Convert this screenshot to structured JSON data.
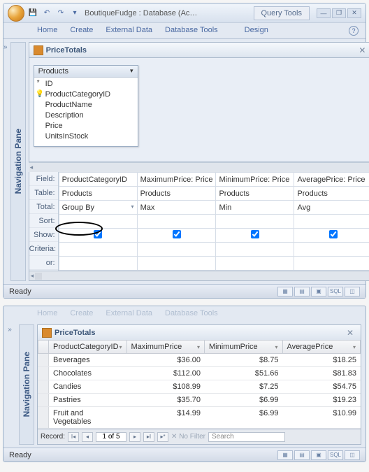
{
  "app_title": "BoutiqueFudge : Database (Ac…",
  "query_tools": "Query Tools",
  "ribbon": [
    "Home",
    "Create",
    "External Data",
    "Database Tools"
  ],
  "design_tab": "Design",
  "nav_pane_label": "Navigation Pane",
  "object_tab": "PriceTotals",
  "table_box": {
    "title": "Products",
    "fields": [
      "ID",
      "ProductCategoryID",
      "ProductName",
      "Description",
      "Price",
      "UnitsInStock"
    ]
  },
  "grid_labels": [
    "Field:",
    "Table:",
    "Total:",
    "Sort:",
    "Show:",
    "Criteria:",
    "or:"
  ],
  "grid": [
    {
      "field": "ProductCategoryID",
      "table": "Products",
      "total": "Group By",
      "show": true
    },
    {
      "field": "MaximumPrice: Price",
      "table": "Products",
      "total": "Max",
      "show": true
    },
    {
      "field": "MinimumPrice: Price",
      "table": "Products",
      "total": "Min",
      "show": true
    },
    {
      "field": "AveragePrice: Price",
      "table": "Products",
      "total": "Avg",
      "show": true
    }
  ],
  "status_text": "Ready",
  "view_icons": [
    "▦",
    "▤",
    "▣",
    "SQL",
    "◫"
  ],
  "datasheet": {
    "columns": [
      "ProductCategoryID",
      "MaximumPrice",
      "MinimumPrice",
      "AveragePrice"
    ],
    "rows": [
      {
        "cat": "Beverages",
        "max": "$36.00",
        "min": "$8.75",
        "avg": "$18.25"
      },
      {
        "cat": "Chocolates",
        "max": "$112.00",
        "min": "$51.66",
        "avg": "$81.83"
      },
      {
        "cat": "Candies",
        "max": "$108.99",
        "min": "$7.25",
        "avg": "$54.75"
      },
      {
        "cat": "Pastries",
        "max": "$35.70",
        "min": "$6.99",
        "avg": "$19.23"
      },
      {
        "cat": "Fruit and Vegetables",
        "max": "$14.99",
        "min": "$6.99",
        "avg": "$10.99"
      }
    ]
  },
  "record_nav": {
    "label": "Record:",
    "pos": "1 of 5",
    "nofilter": "No Filter",
    "search": "Search"
  }
}
